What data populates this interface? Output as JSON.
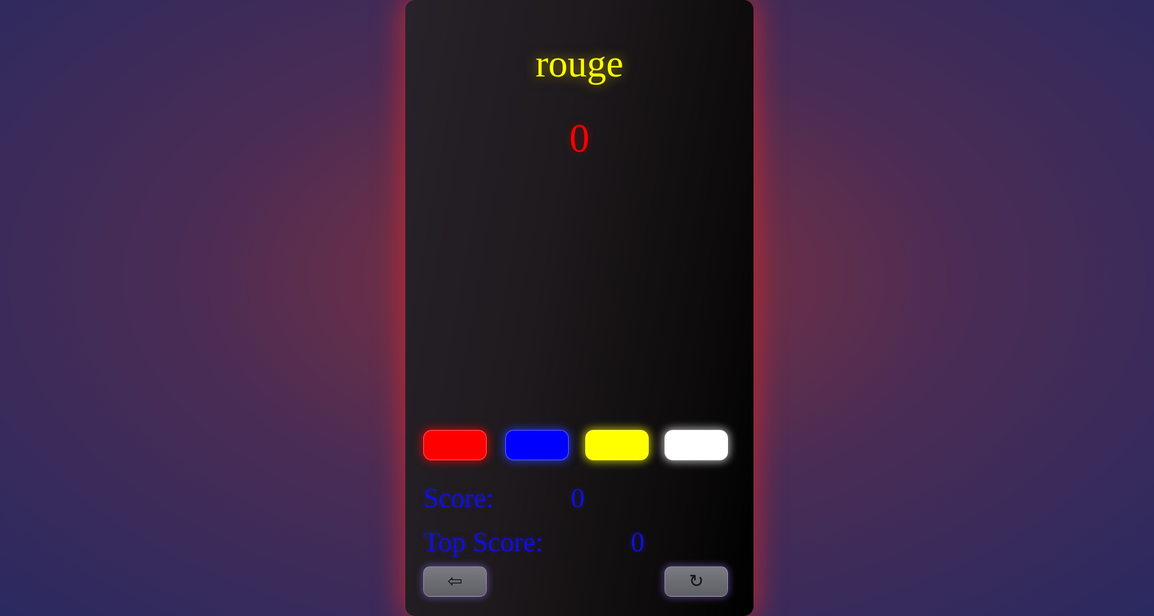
{
  "game": {
    "word": "rouge",
    "counter": "0"
  },
  "color_buttons": [
    {
      "name": "red",
      "color": "#ff0000"
    },
    {
      "name": "blue",
      "color": "#0000ff"
    },
    {
      "name": "yellow",
      "color": "#ffff00"
    },
    {
      "name": "white",
      "color": "#ffffff"
    }
  ],
  "stats": {
    "score_label": "Score:",
    "score_value": "0",
    "top_score_label": "Top Score:",
    "top_score_value": "0"
  },
  "controls": {
    "back_symbol": "⇦",
    "back_icon": "back-arrow-icon",
    "restart_symbol": "↻",
    "restart_icon": "restart-icon"
  },
  "colors": {
    "word": "#ffff00",
    "counter": "#ff0000",
    "stats_text": "#1010dd",
    "panel_glow": "#d2282d"
  }
}
